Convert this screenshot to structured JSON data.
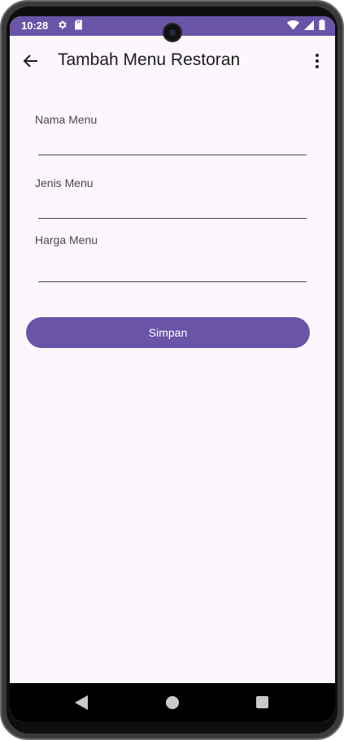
{
  "status_bar": {
    "time": "10:28",
    "background_color": "#6a54a8",
    "left_icons": [
      "gear-icon",
      "sd-card-icon"
    ],
    "right_icons": [
      "wifi-icon",
      "cell-signal-icon",
      "battery-icon"
    ]
  },
  "app_bar": {
    "title": "Tambah Menu Restoran",
    "back_icon": "arrow-back-icon",
    "menu_icon": "more-vert-icon"
  },
  "form": {
    "fields": [
      {
        "label": "Nama Menu",
        "value": ""
      },
      {
        "label": "Jenis Menu",
        "value": ""
      },
      {
        "label": "Harga Menu",
        "value": ""
      }
    ],
    "submit_label": "Simpan"
  },
  "nav_bar": {
    "icons": [
      "nav-back-icon",
      "nav-home-icon",
      "nav-recents-icon"
    ]
  },
  "colors": {
    "accent": "#6a54a8",
    "surface": "#fdf7fd"
  }
}
